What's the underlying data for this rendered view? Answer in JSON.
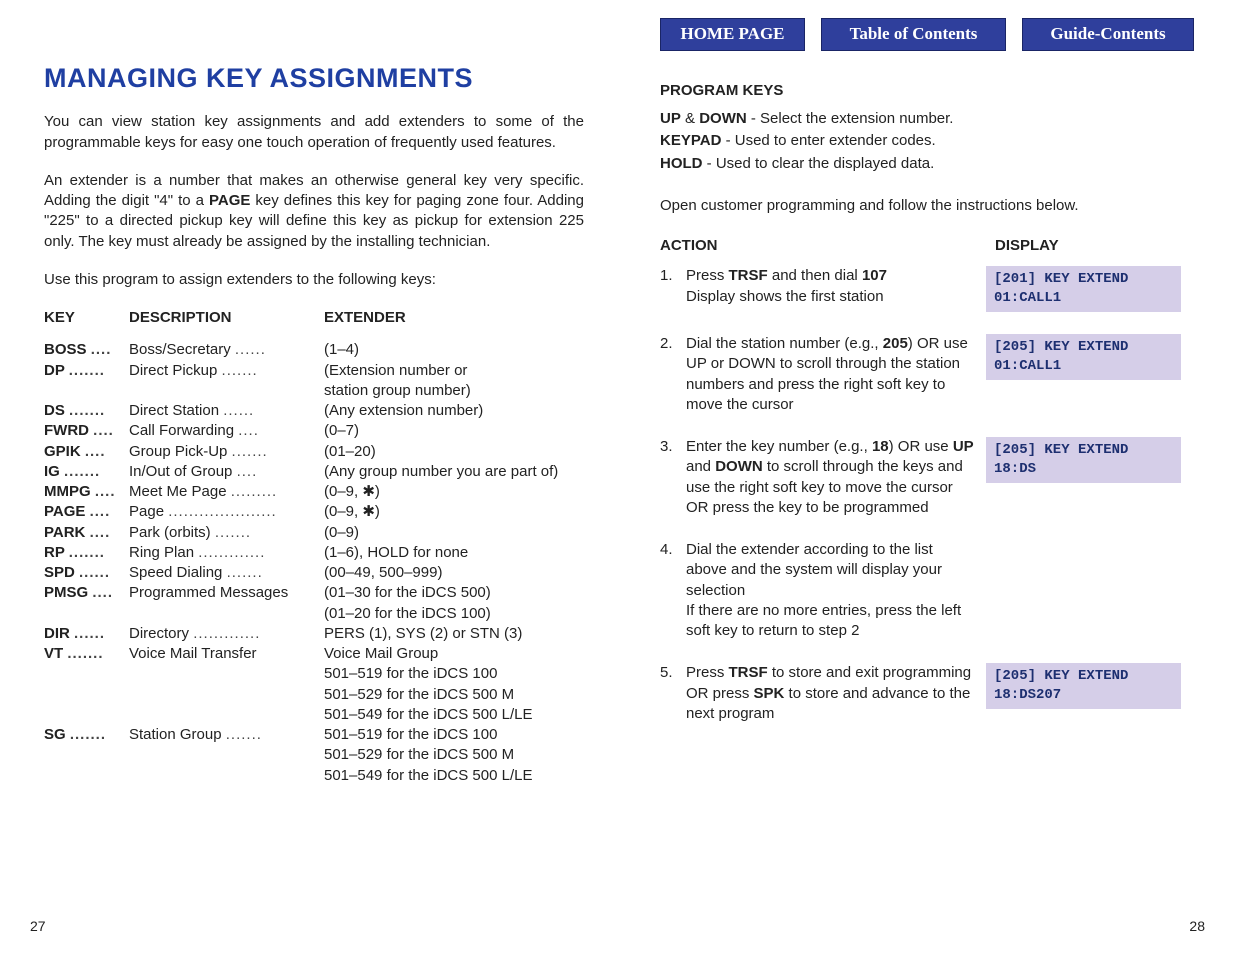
{
  "nav": {
    "home": "HOME PAGE",
    "toc": "Table of Contents",
    "guide": "Guide-Contents"
  },
  "title": "MANAGING KEY ASSIGNMENTS",
  "paras": {
    "p1": "You can view station key assignments and add extenders to some of the programmable keys for easy one touch operation of frequently used features.",
    "p3": "Use this program to assign extenders to the following keys:"
  },
  "p2_parts": {
    "a": "An extender is a number that makes an otherwise general key very specific. Adding the digit \"4\" to a ",
    "b": "PAGE",
    "c": " key defines this key for paging zone four. Adding \"225\" to a directed pickup key will define this key as pickup for extension 225 only. The key must already be assigned by the installing technician."
  },
  "key_table": {
    "head": {
      "key": "KEY",
      "desc": "DESCRIPTION",
      "ext": "EXTENDER"
    },
    "rows": [
      {
        "k": "BOSS",
        "d": "Boss/Secretary",
        "e": "(1–4)"
      },
      {
        "k": "DP",
        "d": "Direct Pickup",
        "e": "(Extension number or"
      },
      {
        "k": "",
        "d": "",
        "e": "station group number)"
      },
      {
        "k": "DS",
        "d": "Direct Station",
        "e": "(Any extension number)"
      },
      {
        "k": "FWRD",
        "d": "Call Forwarding",
        "e": "(0–7)"
      },
      {
        "k": "GPIK",
        "d": "Group Pick-Up",
        "e": "(01–20)"
      },
      {
        "k": "IG",
        "d": "In/Out of Group",
        "e": "(Any group number you are part of)"
      },
      {
        "k": "MMPG",
        "d": "Meet Me Page",
        "e": "(0–9, ✱)"
      },
      {
        "k": "PAGE",
        "d": "Page",
        "e": "(0–9, ✱)"
      },
      {
        "k": "PARK",
        "d": "Park (orbits)",
        "e": "(0–9)"
      },
      {
        "k": "RP",
        "d": "Ring Plan",
        "e": "(1–6), HOLD for none"
      },
      {
        "k": "SPD",
        "d": "Speed Dialing",
        "e": "(00–49, 500–999)"
      },
      {
        "k": "PMSG",
        "d": "Programmed Messages",
        "e": "(01–30 for the iDCS 500)"
      },
      {
        "k": "",
        "d": "",
        "e": "(01–20 for the iDCS 100)"
      },
      {
        "k": "DIR",
        "d": "Directory",
        "e": "PERS (1), SYS (2) or STN (3)"
      },
      {
        "k": "VT",
        "d": "Voice Mail Transfer",
        "e": "Voice Mail Group"
      },
      {
        "k": "",
        "d": "",
        "e": "501–519 for the iDCS 100"
      },
      {
        "k": "",
        "d": "",
        "e": "501–529 for the iDCS 500 M"
      },
      {
        "k": "",
        "d": "",
        "e": "501–549 for the iDCS 500 L/LE"
      },
      {
        "k": "SG",
        "d": "Station Group",
        "e": "501–519 for the iDCS 100"
      },
      {
        "k": "",
        "d": "",
        "e": "501–529 for the iDCS 500 M"
      },
      {
        "k": "",
        "d": "",
        "e": "501–549 for the iDCS 500 L/LE"
      }
    ]
  },
  "program_keys": {
    "head": "PROGRAM KEYS",
    "lines": [
      {
        "b1": "UP",
        "mid": " & ",
        "b2": "DOWN",
        "rest": " - Select the extension number."
      },
      {
        "b1": "KEYPAD",
        "mid": "",
        "b2": "",
        "rest": " - Used to enter extender codes."
      },
      {
        "b1": "HOLD",
        "mid": "",
        "b2": "",
        "rest": " - Used to clear the displayed data."
      }
    ],
    "open": "Open customer programming and follow the instructions below."
  },
  "ad": {
    "action": "ACTION",
    "display": "DISPLAY"
  },
  "steps": [
    {
      "n": "1.",
      "html": "Press <b>TRSF</b> and then dial <b>107</b><br>Display shows the first station",
      "disp": "[201] KEY EXTEND\n01:CALL1"
    },
    {
      "n": "2.",
      "html": "Dial the station number (e.g., <b>205</b>) OR use UP or DOWN to scroll through the station numbers and press the right soft key to move the cursor",
      "disp": "[205] KEY EXTEND\n01:CALL1"
    },
    {
      "n": "3.",
      "html": "Enter the key number (e.g., <b>18</b>) OR use <b>UP</b> and <b>DOWN</b> to scroll through the keys and use the right soft key to move the cursor OR press the key to be programmed",
      "disp": "[205] KEY EXTEND\n18:DS"
    },
    {
      "n": "4.",
      "html": "Dial the extender according to the list above and the system will display your selection<br>If there are no more entries, press the left soft key to return to step 2",
      "disp": ""
    },
    {
      "n": "5.",
      "html": "Press <b>TRSF</b> to store and exit programming OR press <b>SPK</b> to store and advance to the next program",
      "disp": "[205] KEY EXTEND\n18:DS207"
    }
  ],
  "page_left": "27",
  "page_right": "28"
}
